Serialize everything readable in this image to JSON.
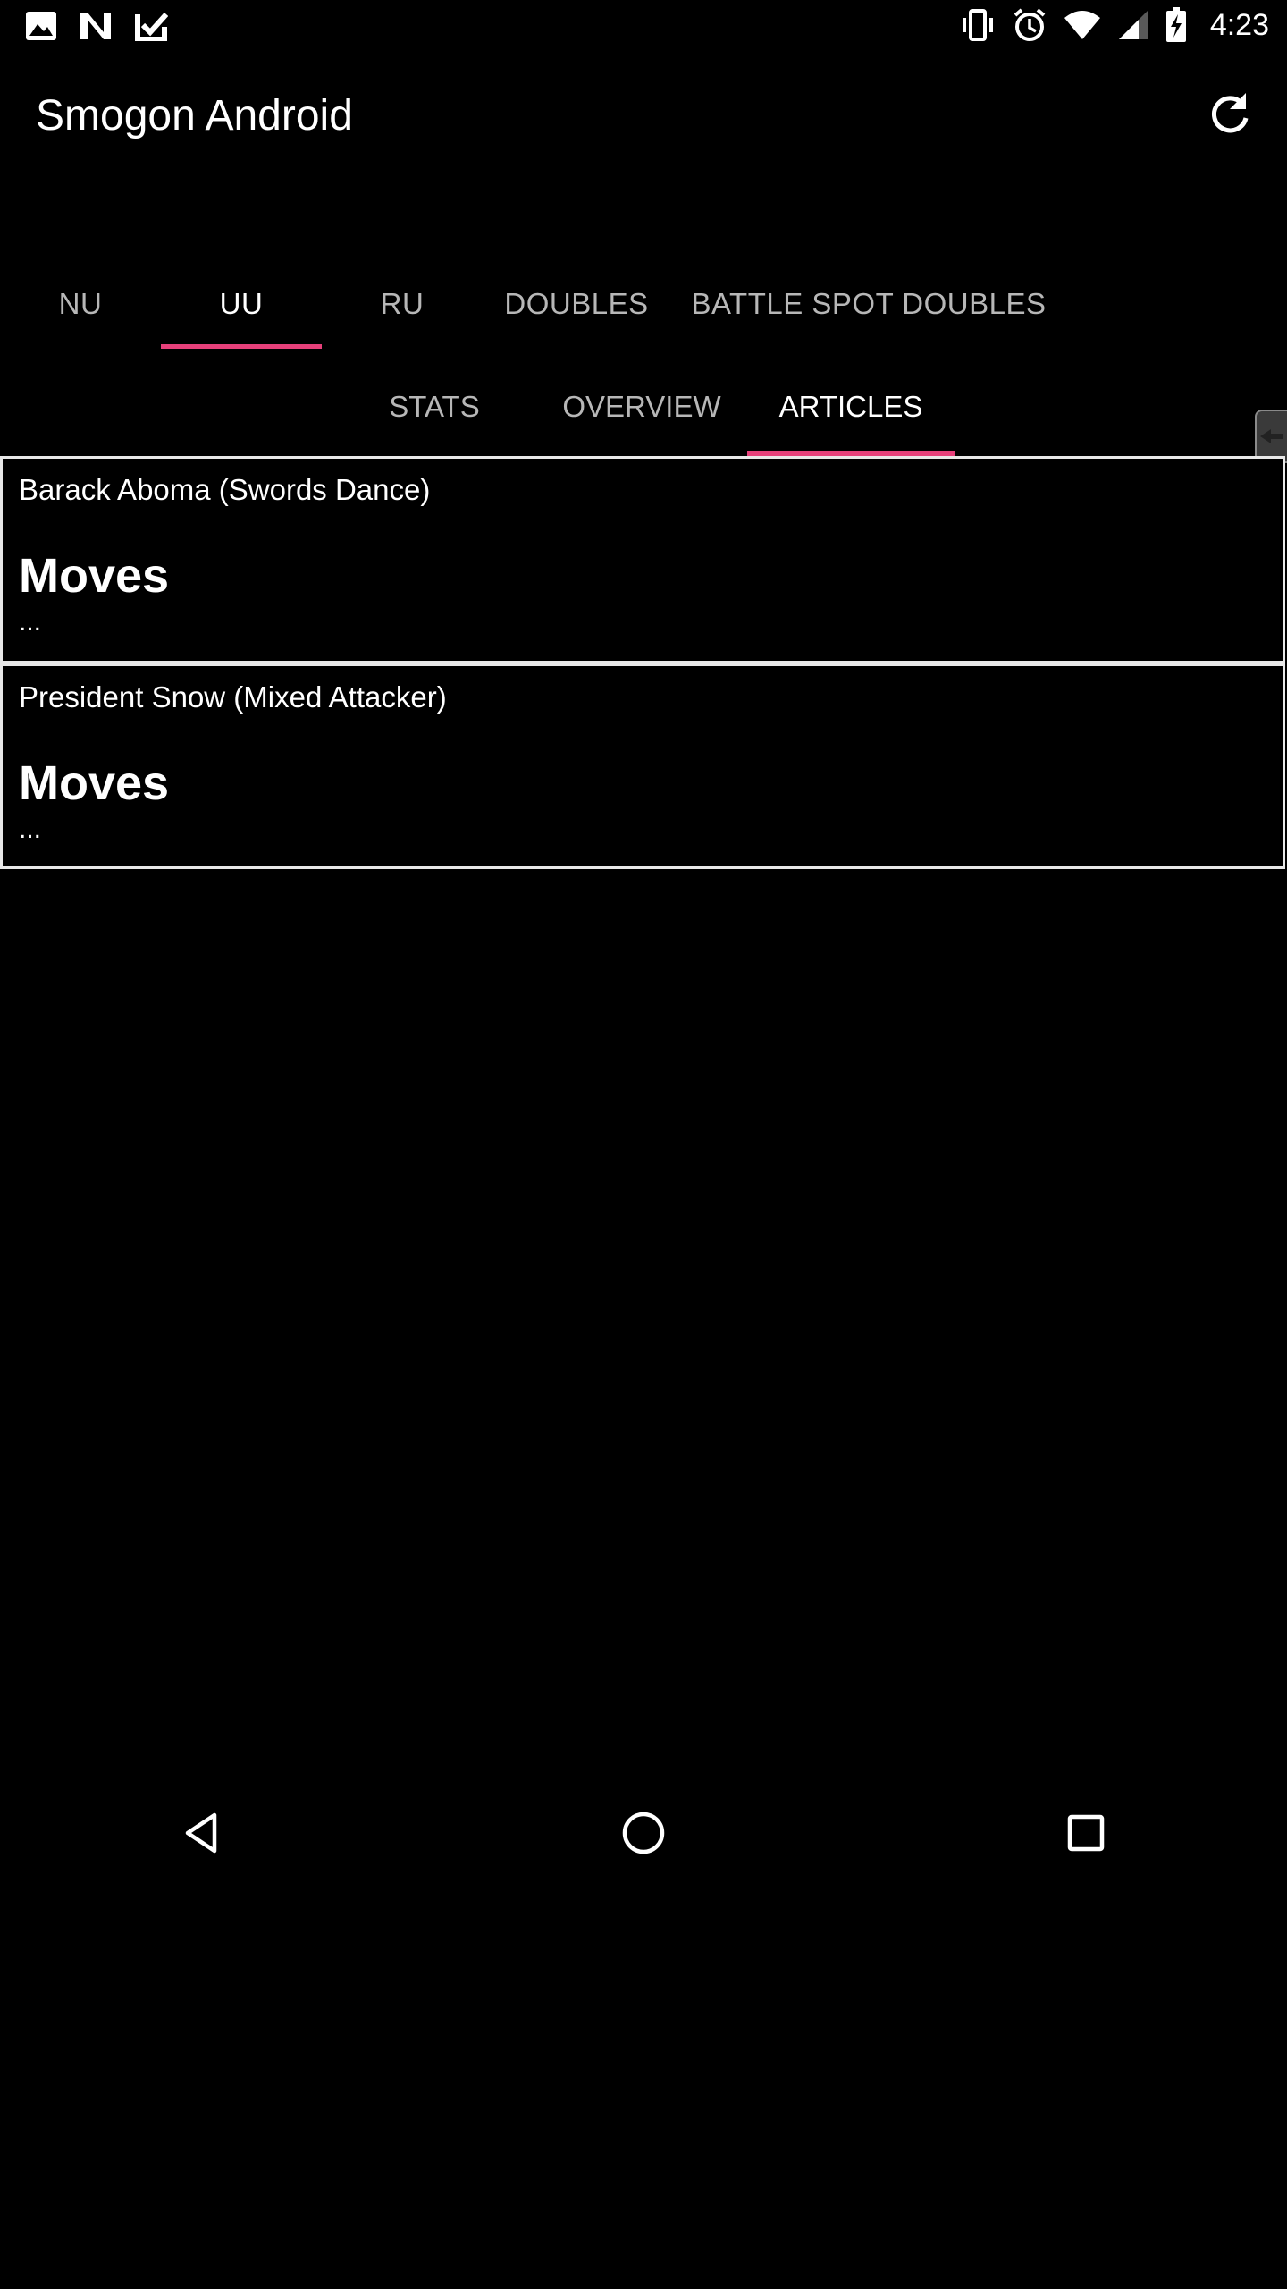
{
  "status_bar": {
    "time": "4:23",
    "left_icons": [
      "image-icon",
      "n-notification-icon",
      "task-check-icon"
    ],
    "right_icons": [
      "vibrate-icon",
      "alarm-icon",
      "wifi-icon",
      "signal-icon",
      "battery-charging-icon"
    ]
  },
  "toolbar": {
    "title": "Smogon Android",
    "refresh_icon": "refresh-icon"
  },
  "primary_tabs": [
    {
      "label": "NU",
      "active": false
    },
    {
      "label": "UU",
      "active": true
    },
    {
      "label": "RU",
      "active": false
    },
    {
      "label": "DOUBLES",
      "active": false
    },
    {
      "label": "BATTLE SPOT DOUBLES",
      "active": false
    }
  ],
  "secondary_tabs": [
    {
      "label": "STATS",
      "active": false
    },
    {
      "label": "OVERVIEW",
      "active": false
    },
    {
      "label": "ARTICLES",
      "active": true
    }
  ],
  "articles": [
    {
      "title": "Barack Aboma (Swords Dance)",
      "heading": "Moves",
      "excerpt": "..."
    },
    {
      "title": "President Snow (Mixed Attacker)",
      "heading": "Moves",
      "excerpt": "..."
    }
  ],
  "nav_bar": {
    "icons": [
      "back-icon",
      "home-icon",
      "recents-icon"
    ]
  },
  "colors": {
    "accent": "#e6407a",
    "background": "#000000",
    "inactive_tab": "#b7b7b7"
  }
}
